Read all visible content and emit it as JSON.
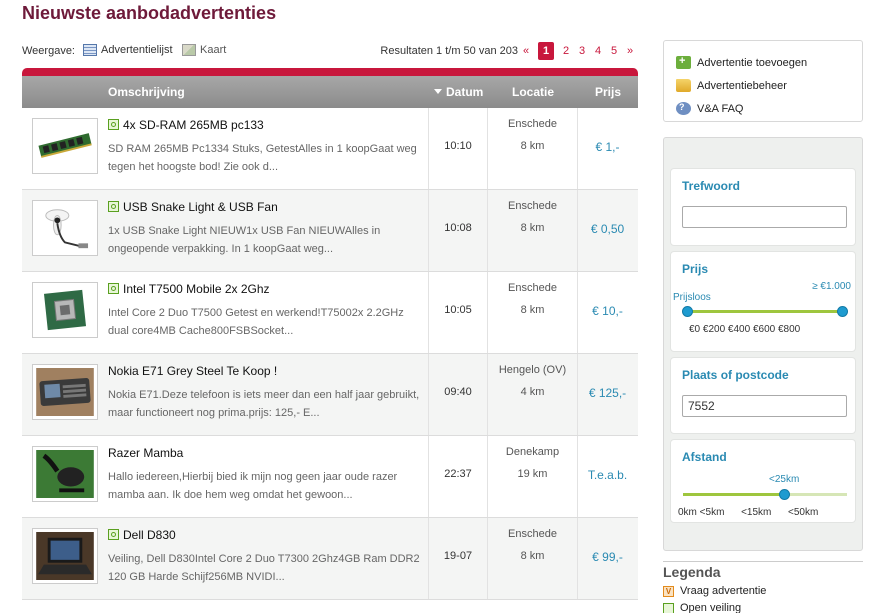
{
  "page_title": "Nieuwste aanbodadvertenties",
  "view": {
    "label": "Weergave:",
    "list_label": "Advertentielijst",
    "map_label": "Kaart",
    "results_text": "Resultaten 1 t/m 50 van 203"
  },
  "pager": {
    "prev": "«",
    "current": "1",
    "pages": [
      "2",
      "3",
      "4",
      "5"
    ],
    "next": "»"
  },
  "table": {
    "col_desc": "Omschrijving",
    "col_date": "Datum",
    "col_loc": "Locatie",
    "col_price": "Prijs"
  },
  "rows": [
    {
      "title": "4x SD-RAM 265MB pc133",
      "desc": "SD RAM 265MB Pc1334 Stuks, GetestAlles in 1 koopGaat weg tegen het hoogste bod! Zie ook d...",
      "time": "10:10",
      "location": "Enschede",
      "distance": "8 km",
      "price": "€ 1,-"
    },
    {
      "title": "USB Snake Light & USB Fan",
      "desc": "1x USB Snake Light NIEUW1x USB Fan NIEUWAlles in ongeopende verpakking. In 1 koopGaat weg...",
      "time": "10:08",
      "location": "Enschede",
      "distance": "8 km",
      "price": "€ 0,50"
    },
    {
      "title": "Intel T7500 Mobile 2x 2Ghz",
      "desc": "Intel Core 2 Duo T7500 Getest en werkend!T75002x 2.2GHz dual core4MB Cache800FSBSocket...",
      "time": "10:05",
      "location": "Enschede",
      "distance": "8 km",
      "price": "€ 10,-"
    },
    {
      "title": "Nokia E71 Grey Steel Te Koop !",
      "desc": "Nokia E71.Deze telefoon is iets meer dan een half jaar gebruikt, maar functioneert nog prima.prijs: 125,- E...",
      "time": "09:40",
      "location": "Hengelo (OV)",
      "distance": "4 km",
      "price": "€ 125,-"
    },
    {
      "title": "Razer Mamba",
      "desc": "Hallo iedereen,Hierbij bied ik mijn nog geen jaar oude razer mamba aan. Ik doe hem weg omdat het gewoon...",
      "time": "22:37",
      "location": "Denekamp",
      "distance": "19 km",
      "price": "T.e.a.b."
    },
    {
      "title": "Dell D830",
      "desc": "Veiling, Dell D830Intel Core 2 Duo T7300 2Ghz4GB Ram DDR2 120 GB Harde Schijf256MB NVIDI...",
      "time": "19-07",
      "location": "Enschede",
      "distance": "8 km",
      "price": "€ 99,-"
    }
  ],
  "actions": {
    "add": "Advertentie toevoegen",
    "manage": "Advertentiebeheer",
    "faq": "V&A FAQ"
  },
  "filters": {
    "keyword_title": "Trefwoord",
    "keyword_value": "",
    "price_title": "Prijs",
    "price_min_label": "Prijsloos",
    "price_max_label": "≥ €1.000",
    "price_ticks": "€0  €200 €400 €600 €800",
    "place_title": "Plaats of postcode",
    "place_value": "7552",
    "distance_title": "Afstand",
    "distance_value_label": "<25km",
    "distance_ticks": "0km <5km      <15km      <50km"
  },
  "legend": {
    "title": "Legenda",
    "request": "Vraag advertentie",
    "auction": "Open veiling"
  },
  "colors": {
    "accent": "#c8173c",
    "title": "#6e1a3a",
    "link": "#2a8ab2",
    "slider": "#9ec63e",
    "knob": "#1e9bd0"
  }
}
